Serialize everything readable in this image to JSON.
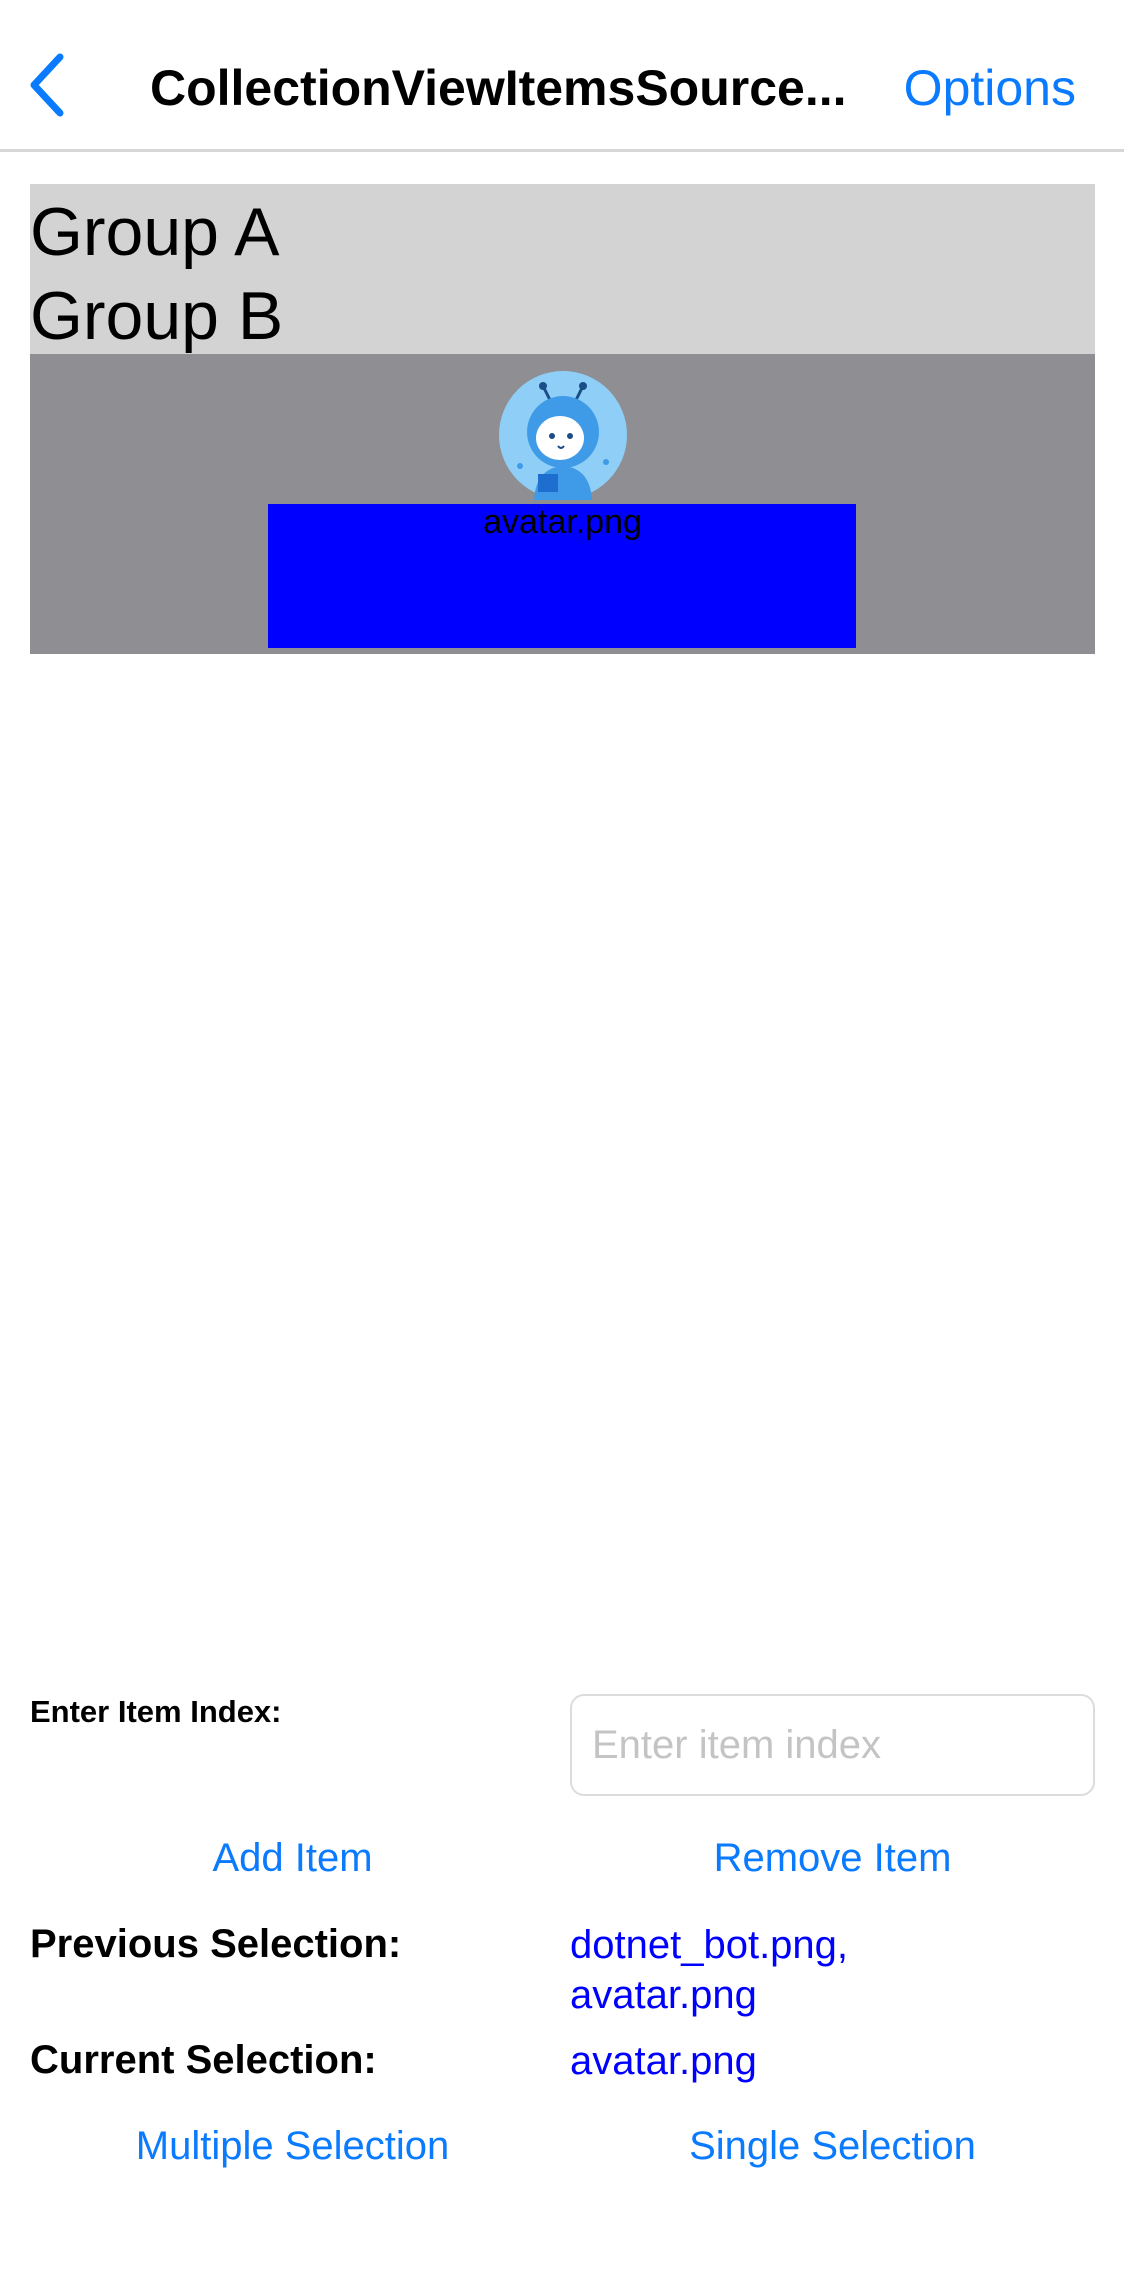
{
  "nav": {
    "back_icon": "chevron-left-icon",
    "title": "CollectionViewItemsSource...",
    "options_label": "Options"
  },
  "collection": {
    "groups": [
      {
        "label": "Group A"
      },
      {
        "label": "Group B"
      }
    ],
    "items": [
      {
        "image_icon": "dotnet-bot-avatar-icon",
        "label": "avatar.png"
      }
    ]
  },
  "controls": {
    "index_label": "Enter Item Index:",
    "index_placeholder": "Enter item index",
    "index_value": "",
    "add_item_label": "Add Item",
    "remove_item_label": "Remove Item",
    "previous_selection_label": "Previous Selection:",
    "previous_selection_line1": "dotnet_bot.png,",
    "previous_selection_line2": "avatar.png",
    "current_selection_label": "Current Selection:",
    "current_selection_value": "avatar.png",
    "multiple_selection_label": "Multiple Selection",
    "single_selection_label": "Single Selection"
  },
  "colors": {
    "accent": "#0a7aff",
    "selection_text": "#0000ff",
    "group_header_bg": "#d3d3d3",
    "group_items_bg": "#8e8e93",
    "item_bg": "#0000ff"
  }
}
